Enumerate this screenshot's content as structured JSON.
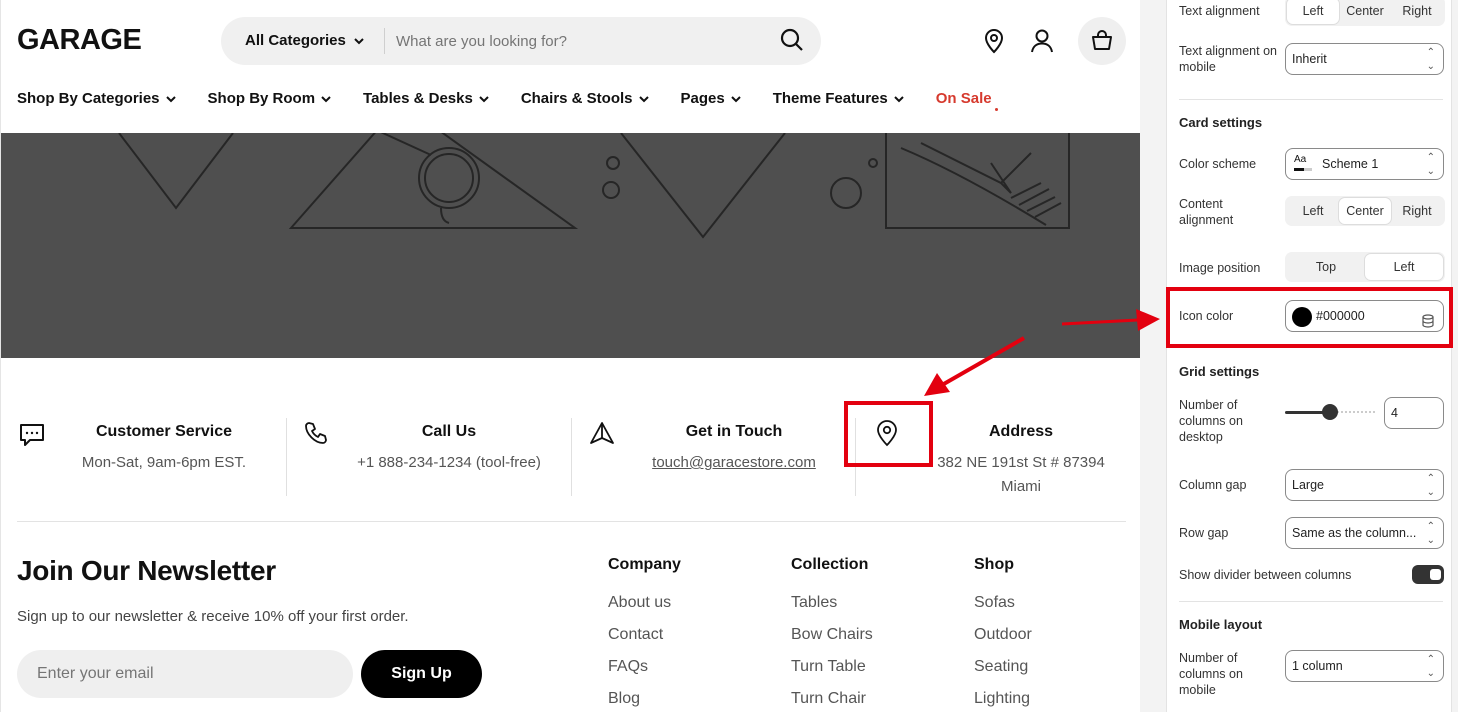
{
  "store": {
    "logo": "GARAGE",
    "search": {
      "category": "All Categories",
      "placeholder": "What are you looking for?"
    },
    "nav": [
      {
        "label": "Shop By Categories",
        "chevron": true
      },
      {
        "label": "Shop By Room",
        "chevron": true
      },
      {
        "label": "Tables & Desks",
        "chevron": true
      },
      {
        "label": "Chairs & Stools",
        "chevron": true
      },
      {
        "label": "Pages",
        "chevron": true
      },
      {
        "label": "Theme Features",
        "chevron": true
      },
      {
        "label": "On Sale",
        "chevron": false
      }
    ],
    "sale_color": "#d63a2e",
    "features": [
      {
        "title": "Customer Service",
        "sub": "Mon-Sat, 9am-6pm EST.",
        "icon": "chat-icon"
      },
      {
        "title": "Call Us",
        "sub": "+1 888-234-1234 (tool-free)",
        "icon": "phone-icon"
      },
      {
        "title": "Get in Touch",
        "sub": "touch@garacestore.com",
        "icon": "send-icon"
      },
      {
        "title": "Address",
        "sub": "382 NE 191st St # 87394 Miami",
        "icon": "map-pin-icon"
      }
    ],
    "newsletter": {
      "title": "Join Our Newsletter",
      "subtitle": "Sign up to our newsletter & receive 10% off your first order.",
      "placeholder": "Enter your email",
      "button": "Sign Up"
    },
    "footer": [
      {
        "heading": "Company",
        "links": [
          "About us",
          "Contact",
          "FAQs",
          "Blog"
        ]
      },
      {
        "heading": "Collection",
        "links": [
          "Tables",
          "Bow Chairs",
          "Turn Table",
          "Turn Chair"
        ]
      },
      {
        "heading": "Shop",
        "links": [
          "Sofas",
          "Outdoor",
          "Seating",
          "Lighting"
        ]
      }
    ]
  },
  "panel": {
    "text_alignment": {
      "label": "Text alignment",
      "options": [
        "Left",
        "Center",
        "Right"
      ],
      "selected": "Left"
    },
    "text_alignment_mobile": {
      "label": "Text alignment on mobile",
      "value": "Inherit"
    },
    "card_settings": {
      "heading": "Card settings"
    },
    "color_scheme": {
      "label": "Color scheme",
      "value": "Scheme 1",
      "swatch_text": "Aa"
    },
    "content_alignment": {
      "label": "Content alignment",
      "options": [
        "Left",
        "Center",
        "Right"
      ],
      "selected": "Center"
    },
    "image_position": {
      "label": "Image position",
      "options": [
        "Top",
        "Left"
      ],
      "selected": "Left"
    },
    "icon_color": {
      "label": "Icon color",
      "value": "#000000",
      "swatch": "#000000"
    },
    "grid_settings": {
      "heading": "Grid settings"
    },
    "columns_desktop": {
      "label": "Number of columns on desktop",
      "value": "4",
      "slider_fraction": 0.5
    },
    "column_gap": {
      "label": "Column gap",
      "value": "Large"
    },
    "row_gap": {
      "label": "Row gap",
      "value": "Same as the column..."
    },
    "show_divider": {
      "label": "Show divider between columns",
      "on": true
    },
    "mobile_layout": {
      "heading": "Mobile layout"
    },
    "columns_mobile": {
      "label": "Number of columns on mobile",
      "value": "1 column"
    }
  },
  "annotation_color": "#e3000f"
}
